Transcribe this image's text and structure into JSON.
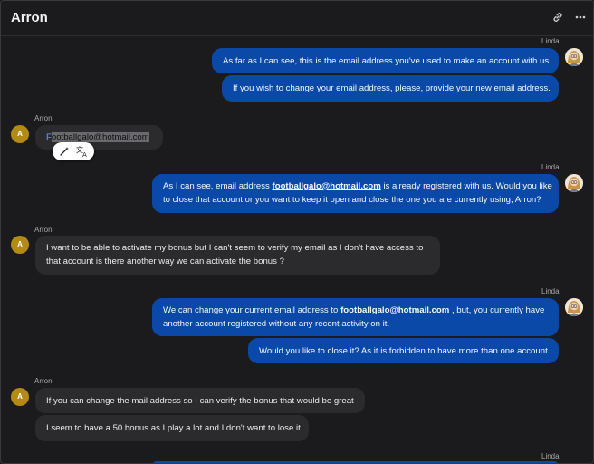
{
  "header": {
    "title": "Arron",
    "link_icon": "link-icon",
    "more_icon": "more-horizontal-icon"
  },
  "colors": {
    "agent_bubble": "#0b49a8",
    "customer_bubble": "#2b2b2e",
    "customer_avatar": "#b38a14",
    "background": "#1b1b1d"
  },
  "customer": {
    "name": "Arron",
    "initial": "A"
  },
  "agent": {
    "name": "Linda"
  },
  "messages": {
    "m1": "As far as I can see, this is the email address you've used to make an account with us.",
    "m2": "If you wish to change your email address, please, provide your new email address.",
    "m3_first": "F",
    "m3_rest": "ootballgalo@hotmail.com",
    "m4_pre": "As I can see, email address ",
    "m4_email": "footballgalo@hotmail.com",
    "m4_post": " is already registered with us. Would you like",
    "m4_line2": "to close that account or you want to keep it open and close the one you are currently using, Arron?",
    "m5_line1": "I want to be able to activate my bonus but I can't seem to verify my email as I don't have access to",
    "m5_line2": "that account is there another way we can activate the bonus ?",
    "m6_pre": "We can change your current email address to ",
    "m6_email": "footballgalo@hotmail.com",
    "m6_post": " , but, you currently have",
    "m6_line2": "another account registered without any recent activity on it.",
    "m7": "Would you like to close it? As it is forbidden to have more than one account.",
    "m8": "If you can change the mail address so I can verify the bonus that would be great",
    "m9": "I seem to have a 50 bonus as I play a lot and I don't want to lose it"
  },
  "popover": {
    "icons": [
      "magic-wand-icon",
      "translate-icon"
    ]
  }
}
